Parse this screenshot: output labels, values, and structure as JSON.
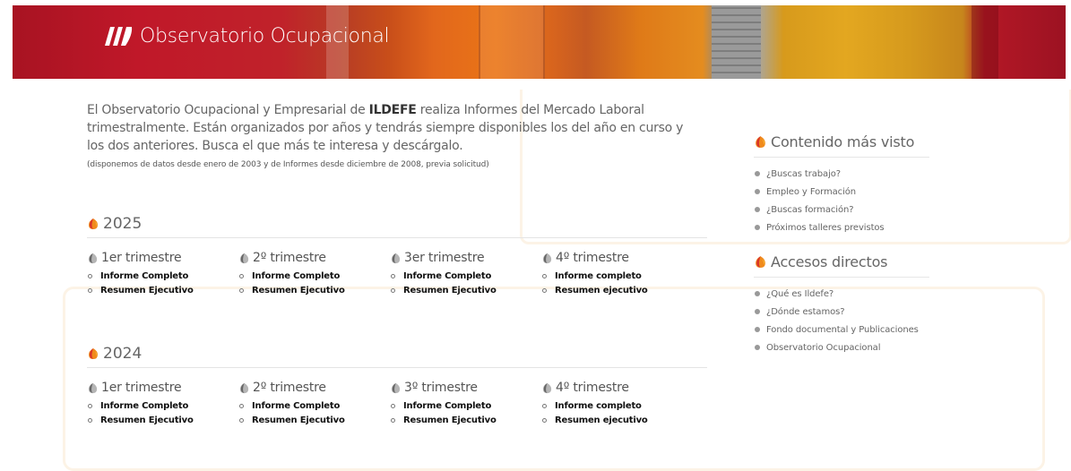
{
  "header": {
    "site_title": "Observatorio Ocupacional",
    "logo_icon": "ildefe-logo-icon"
  },
  "intro": {
    "text_before": "El Observatorio Ocupacional y Empresarial de ",
    "brand": "ILDEFE",
    "text_after": " realiza Informes del Mercado Laboral trimestralmente. Están organizados por años y tendrás siempre disponibles los del año en curso y los dos anteriores. Busca el que más te interesa y descárgalo.",
    "note": "(disponemos de datos desde enero de 2003 y de Informes desde diciembre de 2008, previa solicitud)"
  },
  "years": [
    {
      "year": "2025",
      "quarters": [
        {
          "label": "1er trimestre",
          "links": [
            "Informe Completo",
            "Resumen Ejecutivo"
          ]
        },
        {
          "label": "2º trimestre",
          "links": [
            "Informe Completo",
            "Resumen Ejecutivo"
          ]
        },
        {
          "label": "3er trimestre",
          "links": [
            "Informe Completo",
            "Resumen Ejecutivo"
          ]
        },
        {
          "label": "4º trimestre",
          "links": [
            "Informe completo",
            "Resumen ejecutivo"
          ]
        }
      ]
    },
    {
      "year": "2024",
      "quarters": [
        {
          "label": "1er trimestre",
          "links": [
            "Informe Completo",
            "Resumen Ejecutivo"
          ]
        },
        {
          "label": "2º trimestre",
          "links": [
            "Informe Completo",
            "Resumen Ejecutivo"
          ]
        },
        {
          "label": "3º trimestre",
          "links": [
            "Informe Completo",
            "Resumen Ejecutivo"
          ]
        },
        {
          "label": "4º trimestre",
          "links": [
            "Informe completo",
            "Resumen ejecutivo"
          ]
        }
      ]
    }
  ],
  "sidebar": {
    "most_viewed": {
      "title": "Contenido más visto",
      "items": [
        "¿Buscas trabajo?",
        "Empleo y Formación",
        "¿Buscas formación?",
        "Próximos talleres previstos"
      ]
    },
    "shortcuts": {
      "title": "Accesos directos",
      "items": [
        "¿Qué es Ildefe?",
        "¿Dónde estamos?",
        "Fondo documental y Publicaciones",
        "Observatorio Ocupacional"
      ]
    }
  },
  "colors": {
    "drop_red": "#d8322b",
    "drop_orange": "#f08a1c",
    "drop_yellow": "#f5c23a",
    "drop_gray_dark": "#666666",
    "drop_gray_light": "#b5b5b5"
  }
}
